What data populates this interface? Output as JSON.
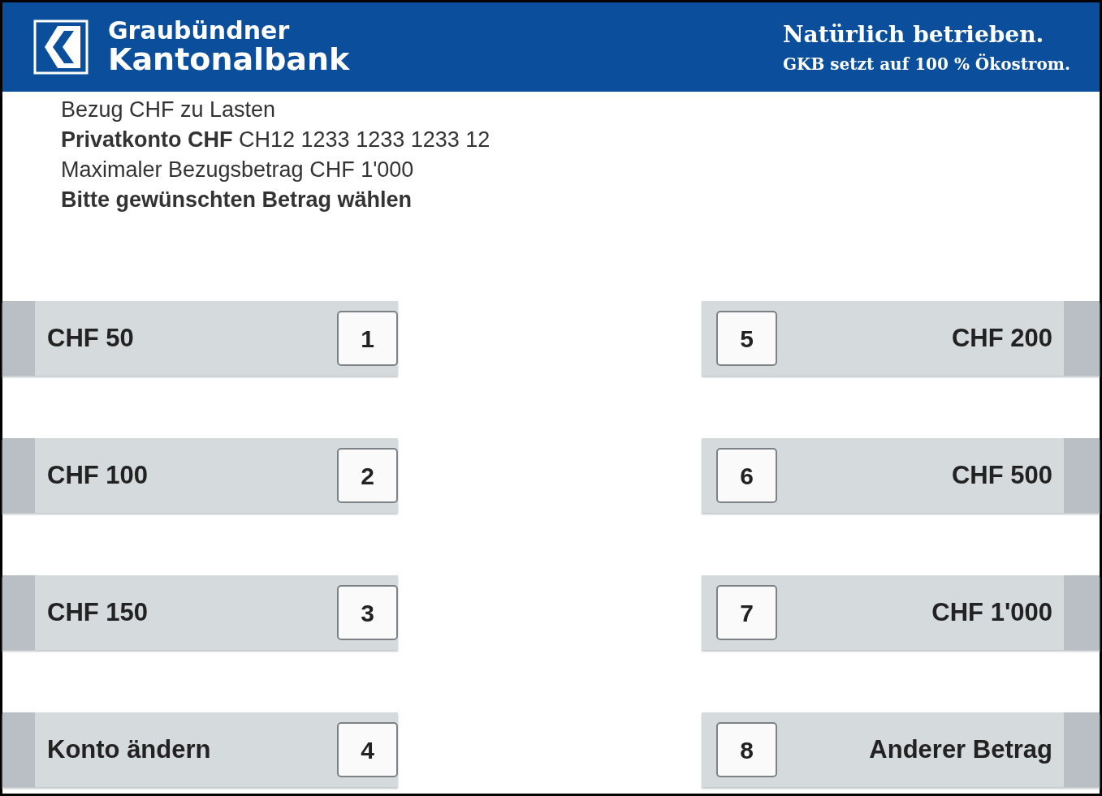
{
  "header": {
    "brand_lines": [
      "Graubündner",
      "Kantonalbank"
    ],
    "slogan": "Natürlich betrieben.",
    "slogan_sub": "GKB setzt auf 100 % Ökostrom."
  },
  "info_lines": [
    {
      "text": "Bezug CHF zu Lasten",
      "kind": "normal"
    },
    {
      "text": "**Privatkonto CHF** CH12 1233 1233 1233 12",
      "kind": "normal"
    },
    {
      "text": "Maximaler Bezugsbetrag CHF 1'000",
      "kind": "normal"
    },
    {
      "text": "Bitte gewünschten Betrag wählen",
      "kind": "bold"
    }
  ],
  "buttons": [
    {
      "label": "CHF 50",
      "key": "1",
      "kind": "left"
    },
    {
      "label": "CHF 200",
      "key": "5",
      "kind": "right"
    },
    {
      "label": "CHF 100",
      "key": "2",
      "kind": "left"
    },
    {
      "label": "CHF 500",
      "key": "6",
      "kind": "right"
    },
    {
      "label": "CHF 150",
      "key": "3",
      "kind": "left"
    },
    {
      "label": "CHF 1'000",
      "key": "7",
      "kind": "right"
    },
    {
      "label": "Konto ändern",
      "key": "4",
      "kind": "left"
    },
    {
      "label": "Anderer Betrag",
      "key": "8",
      "kind": "right"
    }
  ]
}
